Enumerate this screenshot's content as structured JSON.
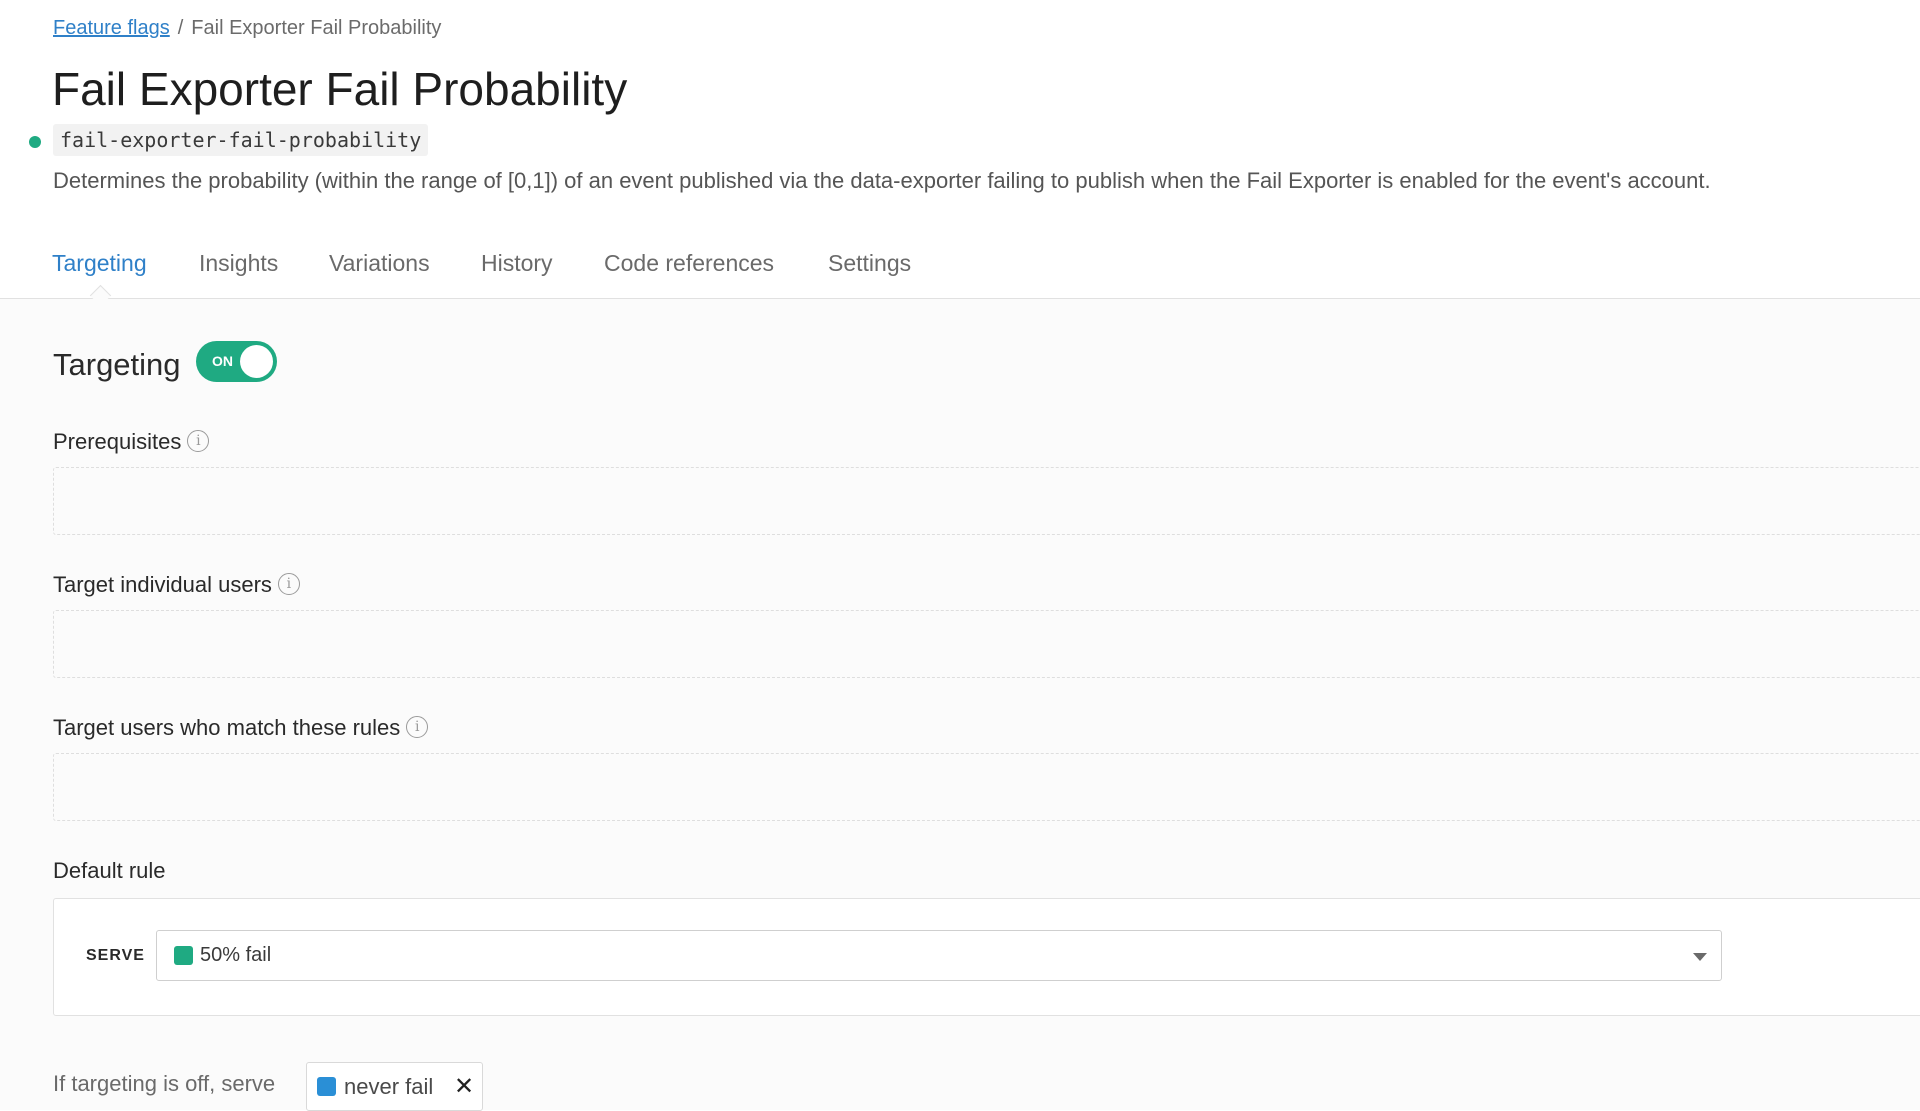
{
  "breadcrumb": {
    "parent_label": "Feature flags",
    "separator": "/",
    "current_label": "Fail Exporter Fail Probability"
  },
  "flag": {
    "title": "Fail Exporter Fail Probability",
    "key": "fail-exporter-fail-probability",
    "status_color": "#1faa82",
    "description": "Determines the probability (within the range of [0,1]) of an event published via the data-exporter failing to publish when the Fail Exporter is enabled for the event's account."
  },
  "tabs": [
    {
      "label": "Targeting",
      "active": true
    },
    {
      "label": "Insights",
      "active": false
    },
    {
      "label": "Variations",
      "active": false
    },
    {
      "label": "History",
      "active": false
    },
    {
      "label": "Code references",
      "active": false
    },
    {
      "label": "Settings",
      "active": false
    }
  ],
  "targeting": {
    "title": "Targeting",
    "toggle_label": "ON",
    "toggle_on": true,
    "toggle_color": "#1faa82"
  },
  "sections": {
    "prerequisites": "Prerequisites",
    "individual_users": "Target individual users",
    "match_rules": "Target users who match these rules",
    "default_rule": "Default rule"
  },
  "info_icon_glyph": "i",
  "default_rule": {
    "serve_label": "SERVE",
    "selected_value": "50% fail",
    "swatch_color": "#1faa82"
  },
  "off_variation": {
    "label": "If targeting is off, serve",
    "value": "never fail",
    "swatch_color": "#2a8fd6",
    "remove_glyph": "✕"
  },
  "colors": {
    "accent": "#2f80c8",
    "on_green": "#1faa82"
  }
}
